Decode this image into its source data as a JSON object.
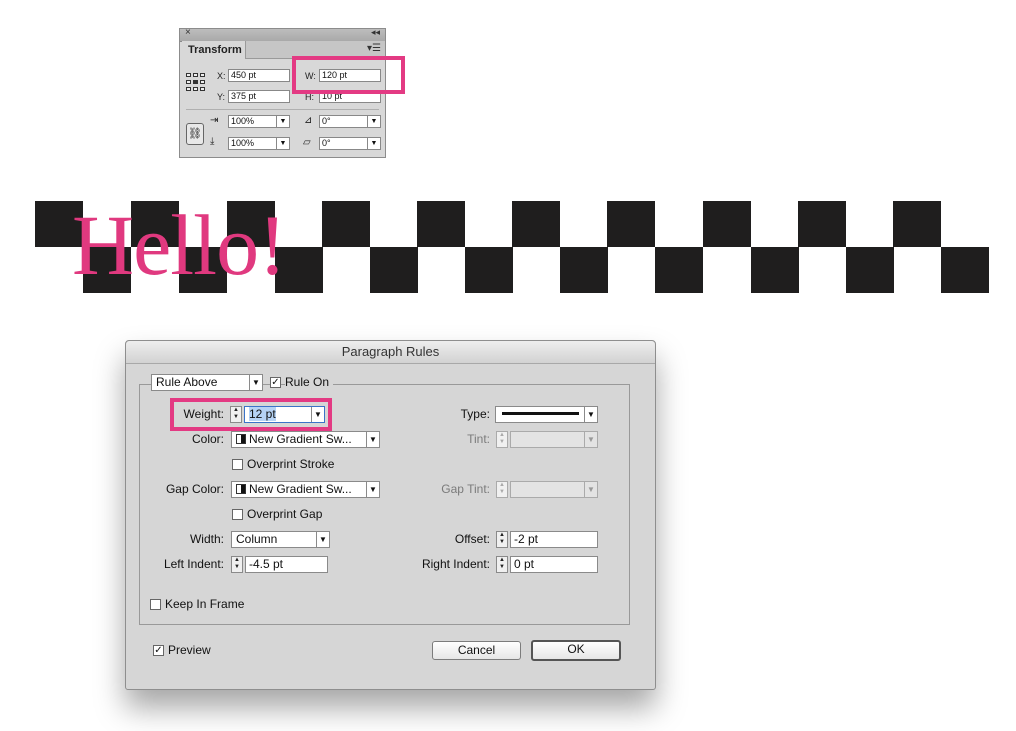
{
  "transform_panel": {
    "close_glyph": "×",
    "collapse_glyph": "◂◂",
    "tab_label": "Transform",
    "menu_glyph": "▾☰",
    "x_label": "X:",
    "x_value": "450 pt",
    "y_label": "Y:",
    "y_value": "375 pt",
    "w_label": "W:",
    "w_value": "120 pt",
    "h_label": "H:",
    "h_value": "10 pt",
    "scale_x": "100%",
    "scale_y": "100%",
    "rotate": "0°",
    "shear": "0°"
  },
  "artwork": {
    "text": "Hello!",
    "text_color": "#e0397f",
    "checker_color": "#1f1e1e"
  },
  "highlight_color": "#e33a83",
  "dialog": {
    "title": "Paragraph Rules",
    "rule_select": "Rule Above",
    "rule_on_label": "Rule On",
    "rule_on_checked": true,
    "weight_label": "Weight:",
    "weight_value": "12 pt",
    "type_label": "Type:",
    "color_label": "Color:",
    "color_value": "New Gradient Sw...",
    "tint_label": "Tint:",
    "overprint_stroke_label": "Overprint Stroke",
    "gap_color_label": "Gap Color:",
    "gap_color_value": "New Gradient Sw...",
    "gap_tint_label": "Gap Tint:",
    "overprint_gap_label": "Overprint Gap",
    "width_label": "Width:",
    "width_value": "Column",
    "offset_label": "Offset:",
    "offset_value": "-2 pt",
    "left_indent_label": "Left Indent:",
    "left_indent_value": "-4.5 pt",
    "right_indent_label": "Right Indent:",
    "right_indent_value": "0 pt",
    "keep_in_frame_label": "Keep In Frame",
    "preview_label": "Preview",
    "preview_checked": true,
    "cancel_label": "Cancel",
    "ok_label": "OK"
  }
}
